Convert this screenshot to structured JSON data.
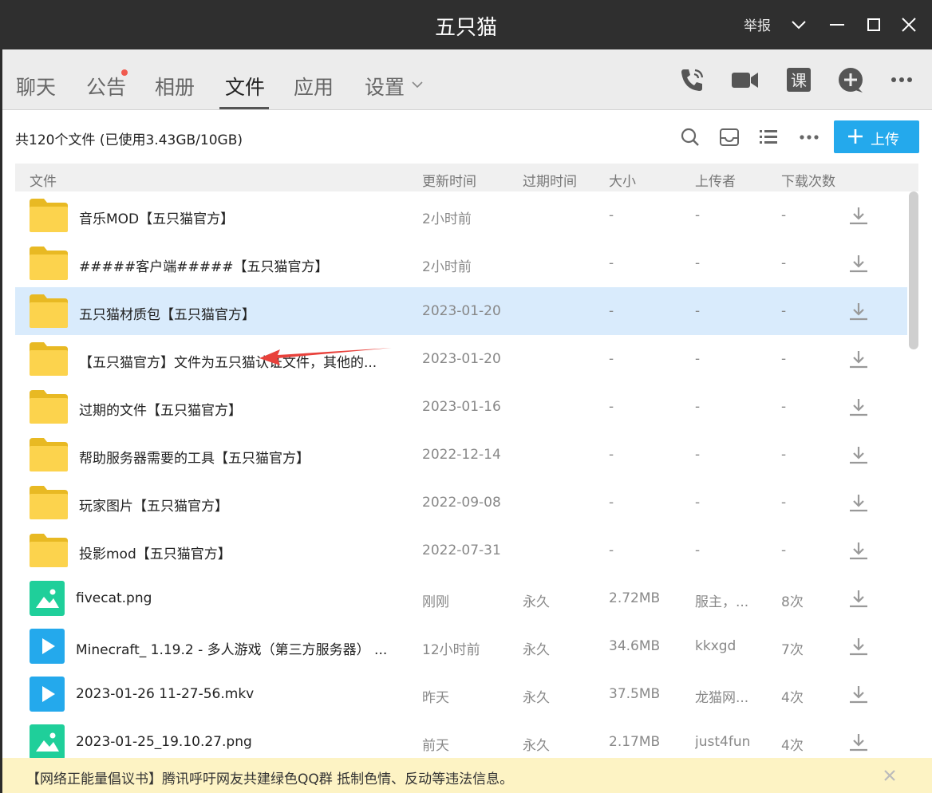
{
  "window": {
    "title": "五只猫",
    "report_label": "举报"
  },
  "nav": {
    "tabs": [
      "聊天",
      "公告",
      "相册",
      "文件",
      "应用",
      "设置"
    ],
    "active": "文件"
  },
  "toolbar": {
    "usage": "共120个文件 (已使用3.43GB/10GB)",
    "upload_label": "上传"
  },
  "table": {
    "headers": [
      "文件",
      "更新时间",
      "过期时间",
      "大小",
      "上传者",
      "下载次数"
    ],
    "rows": [
      {
        "type": "folder",
        "name": "音乐MOD【五只猫官方】",
        "time": "2小时前",
        "expire": "",
        "size": "-",
        "uploader": "-",
        "downloads": "-"
      },
      {
        "type": "folder",
        "name": "#####客户端#####【五只猫官方】",
        "time": "2小时前",
        "expire": "",
        "size": "-",
        "uploader": "-",
        "downloads": "-"
      },
      {
        "type": "folder",
        "name": "五只猫材质包【五只猫官方】",
        "time": "2023-01-20",
        "expire": "",
        "size": "-",
        "uploader": "-",
        "downloads": "-",
        "selected": true
      },
      {
        "type": "folder",
        "name": "【五只猫官方】文件为五只猫认证文件，其他的...",
        "time": "2023-01-20",
        "expire": "",
        "size": "-",
        "uploader": "-",
        "downloads": "-"
      },
      {
        "type": "folder",
        "name": "过期的文件【五只猫官方】",
        "time": "2023-01-16",
        "expire": "",
        "size": "-",
        "uploader": "-",
        "downloads": "-"
      },
      {
        "type": "folder",
        "name": "帮助服务器需要的工具【五只猫官方】",
        "time": "2022-12-14",
        "expire": "",
        "size": "-",
        "uploader": "-",
        "downloads": "-"
      },
      {
        "type": "folder",
        "name": "玩家图片【五只猫官方】",
        "time": "2022-09-08",
        "expire": "",
        "size": "-",
        "uploader": "-",
        "downloads": "-"
      },
      {
        "type": "folder",
        "name": "投影mod【五只猫官方】",
        "time": "2022-07-31",
        "expire": "",
        "size": "-",
        "uploader": "-",
        "downloads": "-"
      },
      {
        "type": "image",
        "name": "fivecat.png",
        "time": "刚刚",
        "expire": "永久",
        "size": "2.72MB",
        "uploader": "服主，...",
        "downloads": "8次"
      },
      {
        "type": "video",
        "name": "Minecraft_ 1.19.2 - 多人游戏（第三方服务器） ...",
        "time": "12小时前",
        "expire": "永久",
        "size": "34.6MB",
        "uploader": "kkxgd",
        "downloads": "7次"
      },
      {
        "type": "video",
        "name": "2023-01-26 11-27-56.mkv",
        "time": "昨天",
        "expire": "永久",
        "size": "37.5MB",
        "uploader": "龙猫网...",
        "downloads": "4次"
      },
      {
        "type": "image",
        "name": "2023-01-25_19.10.27.png",
        "time": "前天",
        "expire": "永久",
        "size": "2.17MB",
        "uploader": "just4fun",
        "downloads": "4次"
      }
    ]
  },
  "notice": {
    "text": "【网络正能量倡议书】腾讯呼吁网友共建绿色QQ群 抵制色情、反动等违法信息。"
  },
  "colors": {
    "accent": "#24a9ec",
    "folder": "#fcd34d",
    "image_icon": "#1fcf9a",
    "video_icon": "#24a9ec",
    "selected_row": "#d9ebfc",
    "arrow": "#e8413b"
  }
}
